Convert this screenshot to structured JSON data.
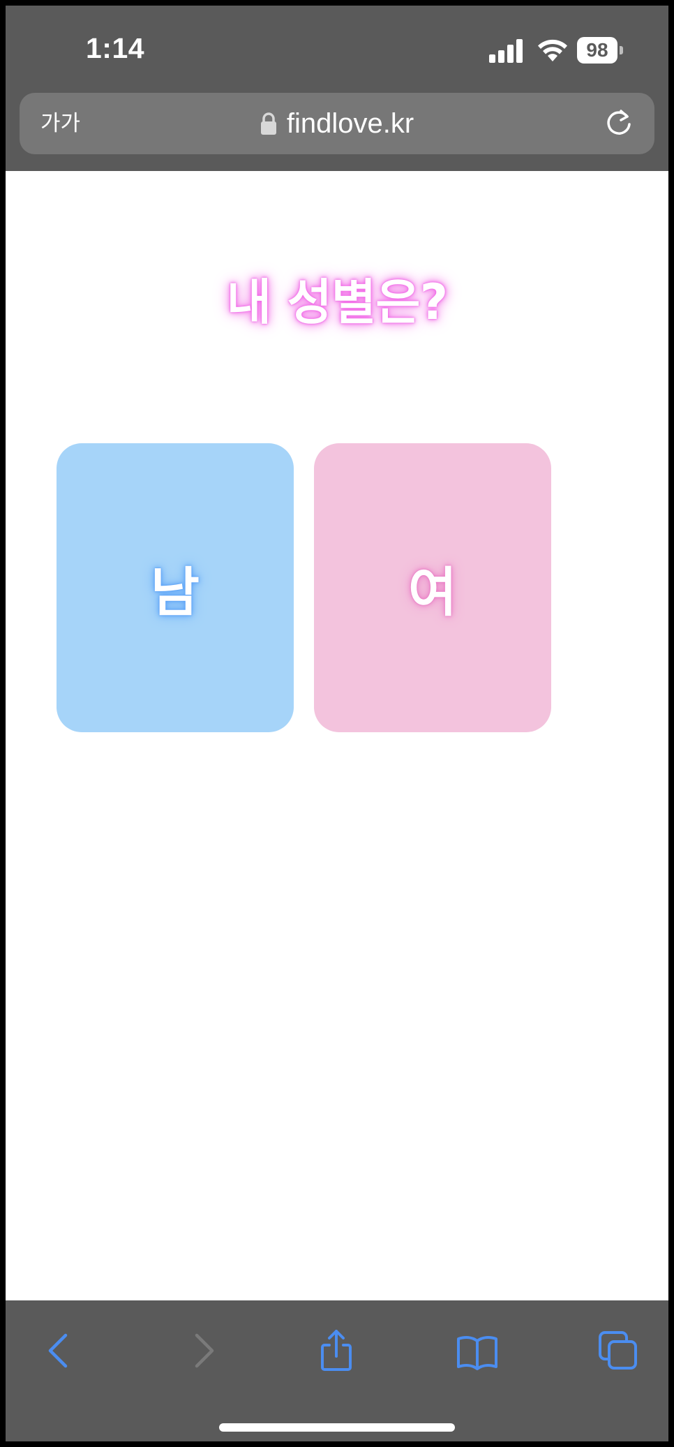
{
  "status_bar": {
    "time": "1:14",
    "battery_level": "98"
  },
  "address_bar": {
    "text_size_label": "가가",
    "url": "findlove.kr"
  },
  "content": {
    "question": "내 성별은?",
    "options": [
      {
        "label": "남",
        "color": "#a6d4f9"
      },
      {
        "label": "여",
        "color": "#f3c3dd"
      }
    ]
  },
  "toolbar": {
    "accent_color": "#4b8df0",
    "buttons": [
      "back-icon",
      "forward-icon",
      "share-icon",
      "bookmarks-icon",
      "tabs-icon"
    ]
  }
}
